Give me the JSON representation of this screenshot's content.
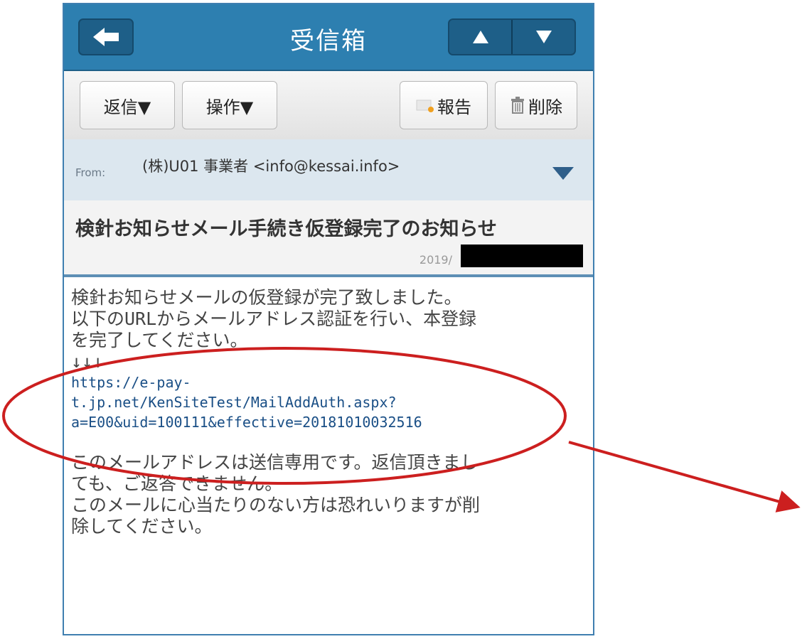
{
  "header": {
    "title": "受信箱",
    "back_icon": "arrow-left-icon",
    "prev_icon": "triangle-up-icon",
    "next_icon": "triangle-down-icon"
  },
  "toolbar": {
    "reply_label": "返信▼",
    "action_label": "操作▼",
    "report_label": "報告",
    "delete_label": "削除"
  },
  "mail": {
    "from_label": "From:",
    "from_value": "(株)U01 事業者 <info@kessai.info>",
    "subject": "検針お知らせメール手続き仮登録完了のお知らせ",
    "date": "2019/",
    "body": {
      "line1": "検針お知らせメールの仮登録が完了致しました。",
      "line2": "以下のURLからメールアドレス認証を行い、本登録",
      "line3": "を完了してください。",
      "arrows": "↓↓↓",
      "url1": "https://e-pay-",
      "url2": "t.jp.net/KenSiteTest/MailAddAuth.aspx?",
      "url3": "a=E00&uid=100111&effective=20181010032516",
      "line4": "このメールアドレスは送信専用です。返信頂きまし",
      "line5": "ても、ご返答できません。",
      "line6": "このメールに心当たりのない方は恐れいりますが削",
      "line7": "除してください。"
    }
  },
  "colors": {
    "header": "#2d7fb0",
    "annotation": "#cc1f1f",
    "link": "#1a4f86"
  }
}
